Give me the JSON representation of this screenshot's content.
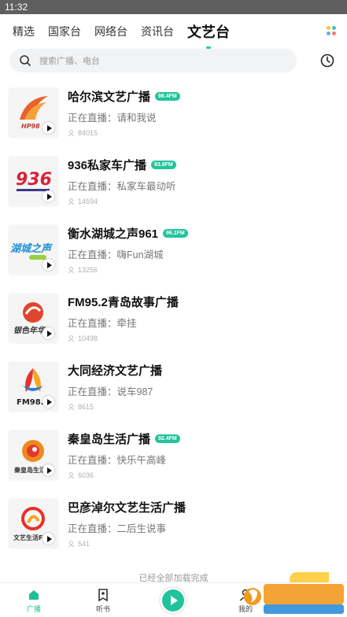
{
  "status_bar": {
    "time": "11:32"
  },
  "tabs": [
    {
      "label": "精选",
      "active": false
    },
    {
      "label": "国家台",
      "active": false
    },
    {
      "label": "网络台",
      "active": false
    },
    {
      "label": "资讯台",
      "active": false
    },
    {
      "label": "文艺台",
      "active": true
    }
  ],
  "search": {
    "placeholder": "搜索广播、电台"
  },
  "live_prefix": "正在直播：",
  "stations": [
    {
      "name": "哈尔滨文艺广播",
      "fm": "98.4",
      "program": "请和我说",
      "listeners": "84015",
      "logo_text": "HP98"
    },
    {
      "name": "936私家车广播",
      "fm": "93.6",
      "program": "私家车最动听",
      "listeners": "14594",
      "logo_text": "936"
    },
    {
      "name": "衡水湖城之声961",
      "fm": "96.1",
      "program": "嗨Fun湖城",
      "listeners": "13256",
      "logo_text": "湖城之声"
    },
    {
      "name": "FM95.2青岛故事广播",
      "fm": null,
      "program": "牵挂",
      "listeners": "10498",
      "logo_text": "银色年华"
    },
    {
      "name": "大同经济文艺广播",
      "fm": null,
      "program": "说车987",
      "listeners": "8615",
      "logo_text": "FM98.7"
    },
    {
      "name": "秦皇岛生活广播",
      "fm": "92.4",
      "program": "快乐午高峰",
      "listeners": "6036",
      "logo_text": "秦皇岛生活"
    },
    {
      "name": "巴彦淖尔文艺生活广播",
      "fm": null,
      "program": "二后生说事",
      "listeners": "541",
      "logo_text": "文艺生活FM"
    }
  ],
  "footer": {
    "loaded_text": "已经全部加载完成"
  },
  "bottom_nav": [
    {
      "label": "广播",
      "active": true
    },
    {
      "label": "听书",
      "active": false
    },
    {
      "label": "我的",
      "active": false
    }
  ],
  "colors": {
    "accent": "#21c49a",
    "badge": "#21c49a",
    "promo": "#ffd14a"
  }
}
